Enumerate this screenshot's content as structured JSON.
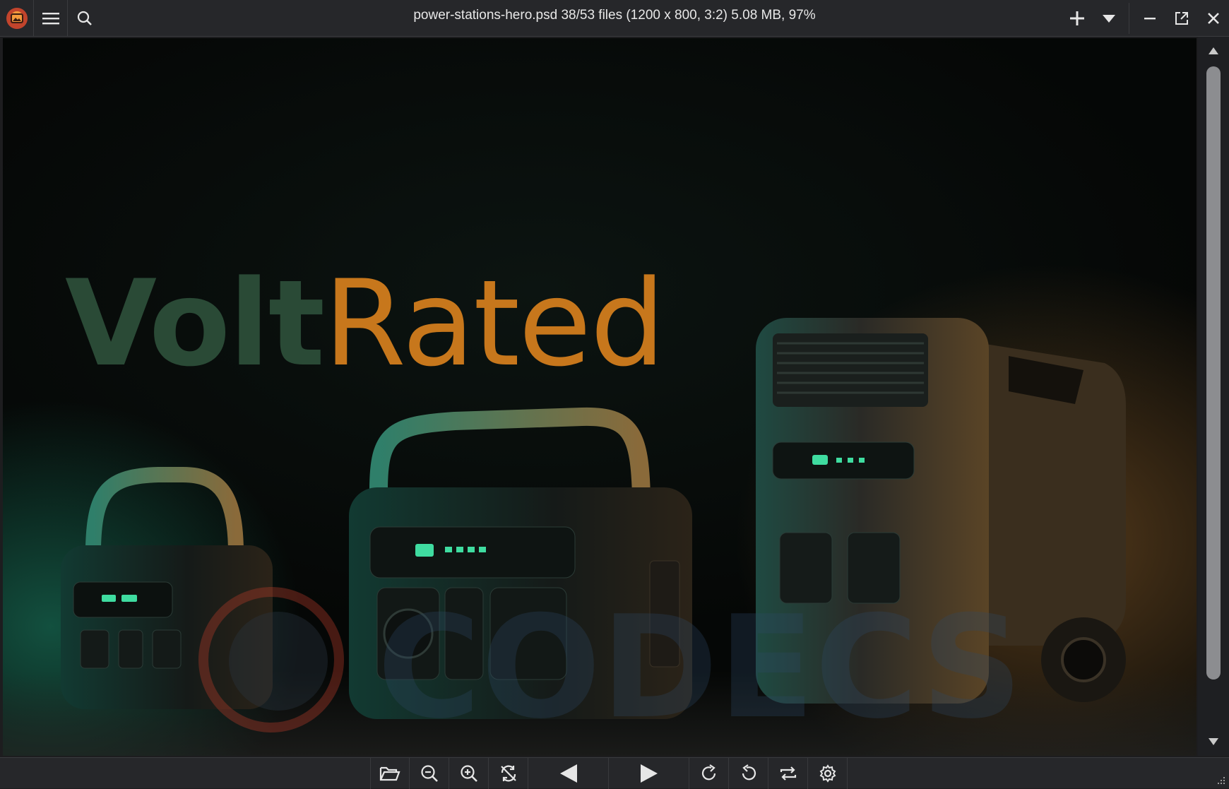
{
  "window": {
    "title": "power-stations-hero.psd 38/53 files (1200 x 800, 3:2) 5.08 MB, 97%"
  },
  "titlebar": {
    "left_icons": [
      "app-logo-icon",
      "menu-icon",
      "search-icon"
    ],
    "right_icons": [
      "plus-icon",
      "dropdown-icon",
      "minimize-icon",
      "maximize-icon",
      "close-icon"
    ]
  },
  "image": {
    "brand_part1": "Volt",
    "brand_part2": "Rated",
    "watermark": "CODECS"
  },
  "toolbar": {
    "icons": [
      "open-folder-icon",
      "zoom-out-icon",
      "zoom-in-icon",
      "fit-toggle-icon",
      "previous-icon",
      "next-icon",
      "rotate-cw-icon",
      "rotate-ccw-icon",
      "flip-icon",
      "settings-icon"
    ]
  },
  "colors": {
    "accent_orange": "#c7771c",
    "brand_green": "#2a4a36",
    "chrome_bg": "#26272a",
    "led_green": "#3fdca0"
  }
}
